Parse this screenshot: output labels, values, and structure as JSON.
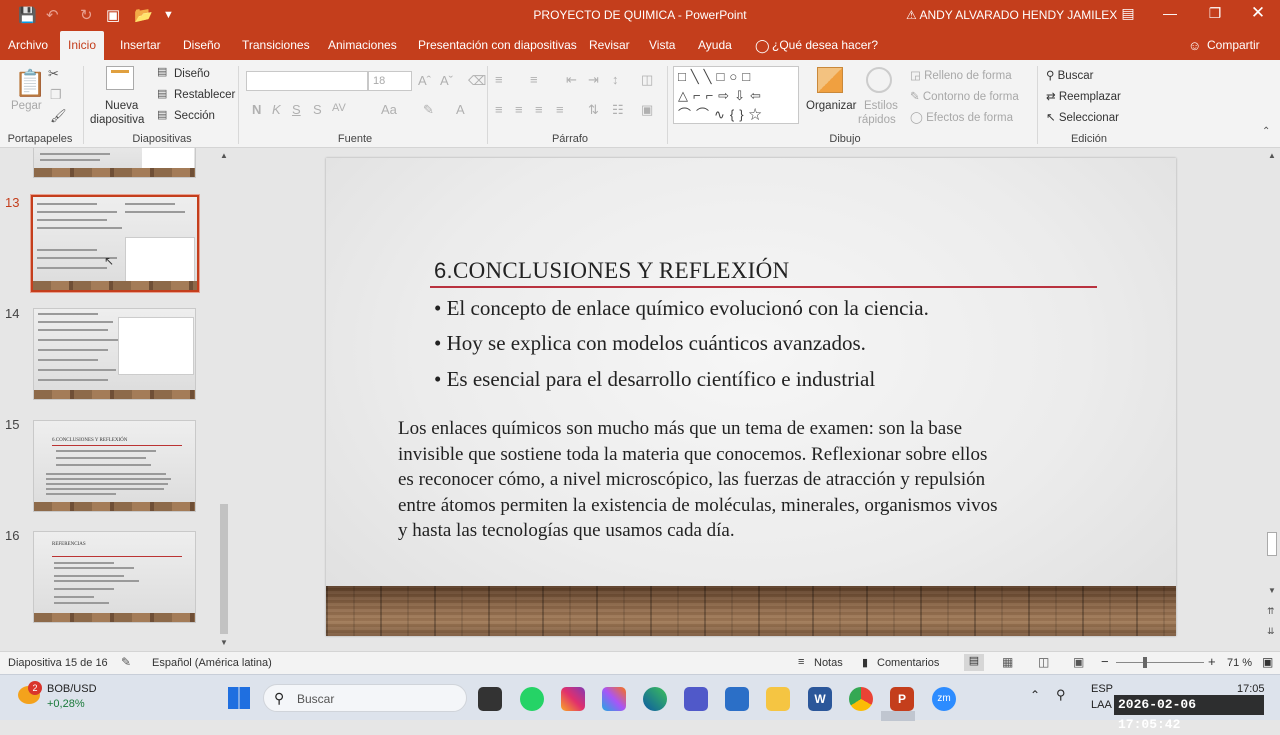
{
  "titlebar": {
    "title": "PROYECTO DE QUIMICA  -  PowerPoint",
    "user": "ANDY ALVARADO HENDY JAMILEX"
  },
  "tabs": [
    "Archivo",
    "Inicio",
    "Insertar",
    "Diseño",
    "Transiciones",
    "Animaciones",
    "Presentación con diapositivas",
    "Revisar",
    "Vista",
    "Ayuda",
    "¿Qué desea hacer?"
  ],
  "share_label": "Compartir",
  "ribbon": {
    "clipboard": {
      "paste": "Pegar",
      "group": "Portapapeles"
    },
    "slides": {
      "new_slide_1": "Nueva",
      "new_slide_2": "diapositiva",
      "layout": "Diseño",
      "reset": "Restablecer",
      "section": "Sección",
      "group": "Diapositivas"
    },
    "font": {
      "size": "18",
      "bold": "N",
      "italic": "K",
      "underline": "S",
      "strike": "S",
      "spacing": "AV",
      "case": "Aa",
      "group": "Fuente"
    },
    "paragraph": {
      "group": "Párrafo"
    },
    "drawing": {
      "arrange": "Organizar",
      "quick_styles_1": "Estilos",
      "quick_styles_2": "rápidos",
      "fill": "Relleno de forma",
      "outline": "Contorno de forma",
      "effects": "Efectos de forma",
      "group": "Dibujo"
    },
    "editing": {
      "find": "Buscar",
      "replace": "Reemplazar",
      "select": "Seleccionar",
      "group": "Edición"
    }
  },
  "thumbnails": [
    {
      "num": "13",
      "selected": true
    },
    {
      "num": "14",
      "selected": false
    },
    {
      "num": "15",
      "selected": false,
      "title": "6.CONCLUSIONES Y REFLEXIÓN"
    },
    {
      "num": "16",
      "selected": false,
      "title": "REFERENCIAS"
    }
  ],
  "slide": {
    "title_num": "6.",
    "title": "CONCLUSIONES  Y REFLEXIÓN",
    "bullets": [
      "• El concepto de enlace químico evolucionó con la ciencia.",
      "• Hoy se explica con modelos cuánticos avanzados.",
      "• Es esencial para el desarrollo científico e industrial"
    ],
    "paragraph_lines": [
      "Los enlaces químicos son mucho más que un tema de examen: son la base",
      "invisible que sostiene toda la materia que conocemos. Reflexionar sobre ellos",
      "es reconocer cómo, a nivel microscópico, las fuerzas de atracción y repulsión",
      "entre átomos permiten la existencia de moléculas, minerales, organismos vivos",
      "y hasta las tecnologías que usamos cada día."
    ]
  },
  "status": {
    "slide_info": "Diapositiva 15 de 16",
    "language": "Español (América latina)",
    "notes": "Notas",
    "comments": "Comentarios",
    "zoom": "71 %"
  },
  "taskbar": {
    "weather_badge": "2",
    "ticker": "BOB/USD",
    "ticker_change": "+0,28%",
    "search": "Buscar",
    "lang1": "ESP",
    "lang2": "LAA",
    "time": "17:05",
    "timestamp": "2026-02-06  17:05:42"
  },
  "colors": {
    "accent": "#c43e1c",
    "title_rule": "#b9323f"
  }
}
